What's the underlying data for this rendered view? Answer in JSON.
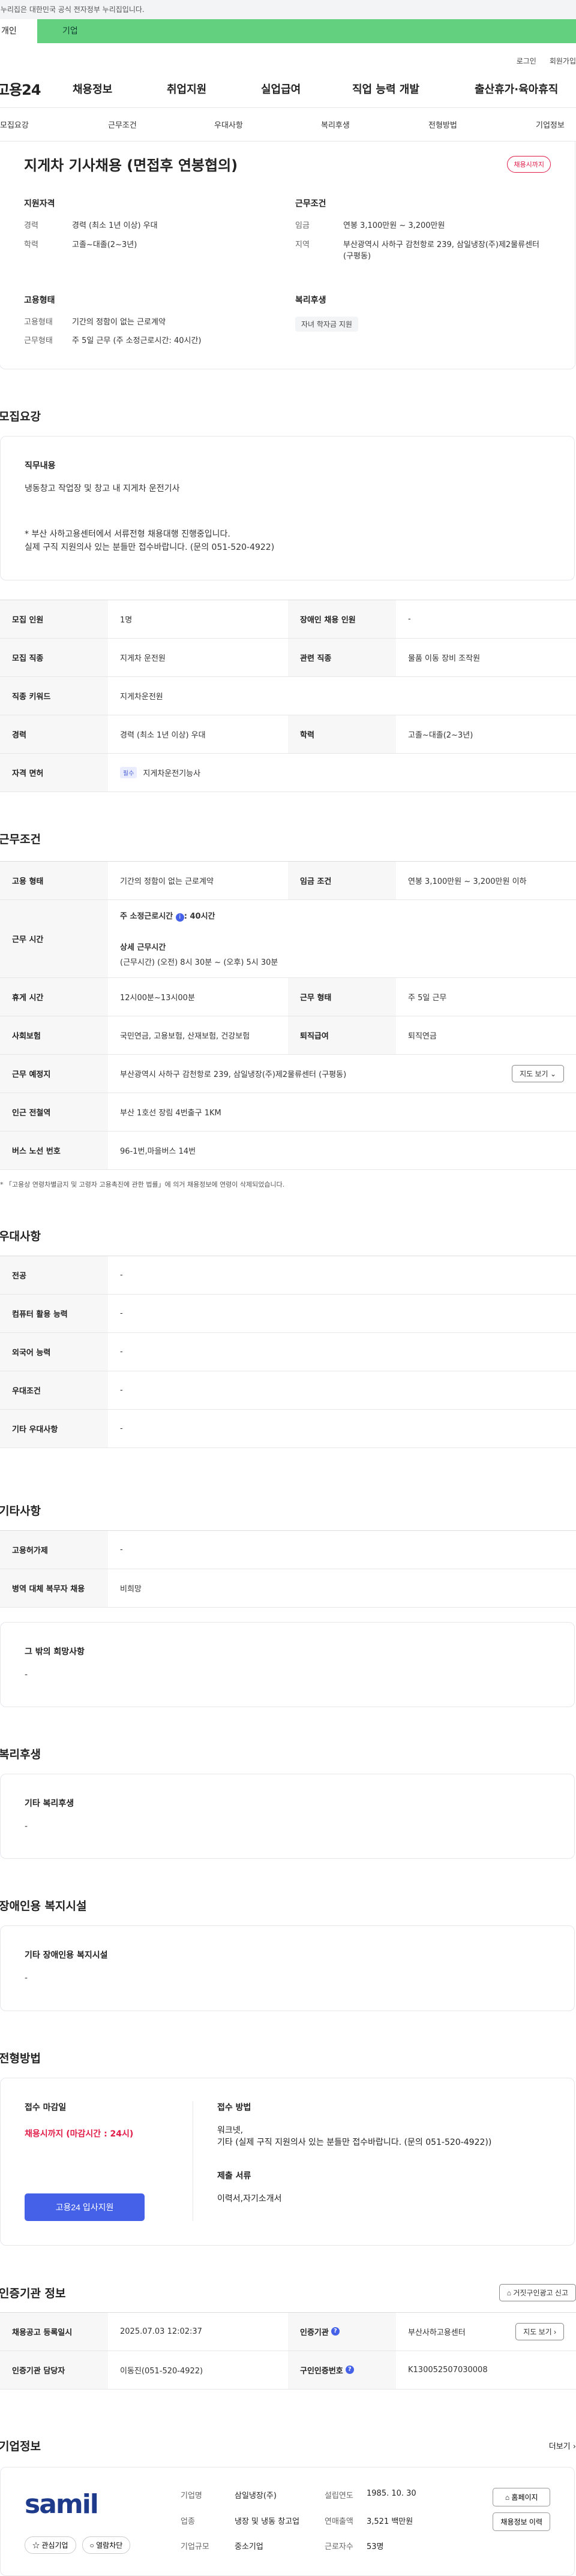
{
  "banner": {
    "text": "이 누리집은 대한민국 공식 전자정부 누리집입니다."
  },
  "user_tabs": {
    "personal": "개인",
    "company": "기업"
  },
  "util": {
    "login": "로그인",
    "join": "회원가입"
  },
  "gnb": {
    "logo": "고용24",
    "items": [
      "채용정보",
      "취업지원",
      "실업급여",
      "직업 능력 개발",
      "출산휴가·육아휴직"
    ]
  },
  "subnav": [
    "모집요강",
    "근무조건",
    "우대사항",
    "복리후생",
    "전형방법",
    "기업정보"
  ],
  "hero": {
    "title": "지게차 기사채용 (면접후 연봉협의)",
    "badge": "채용시까지",
    "qualification": {
      "title": "지원자격",
      "career_k": "경력",
      "career_v": "경력 (최소 1년 이상) 우대",
      "edu_k": "학력",
      "edu_v": "고졸~대졸(2~3년)"
    },
    "conditions": {
      "title": "근무조건",
      "wage_k": "임금",
      "wage_v": "연봉 3,100만원 ~ 3,200만원",
      "loc_k": "지역",
      "loc_v": "부산광역시 사하구 감천항로 239, 삼일냉장(주)제2물류센터 (구평동)"
    },
    "employment": {
      "title": "고용형태",
      "type_k": "고용형태",
      "type_v": "기간의 정함이 없는 근로계약",
      "form_k": "근무형태",
      "form_v": "주 5일 근무 (주 소정근로시간: 40시간)"
    },
    "welfare": {
      "title": "복리후생",
      "chip": "자녀 학자금 지원"
    }
  },
  "recruit": {
    "section": "모집요강",
    "duty_title": "직무내용",
    "duty_text": "냉동창고 작업장 및 창고 내 지게차 운전기사",
    "notice1": "* 부산 사하고용센터에서 서류전형 채용대행 진행중입니다.",
    "notice2": "실제 구직 지원의사 있는 분들만 접수바랍니다. (문의 051-520-4922)",
    "rows": {
      "count_k": "모집 인원",
      "count_v": "1명",
      "disabled_k": "장애인 채용 인원",
      "disabled_v": "-",
      "job_k": "모집 직종",
      "job_v": "지게차 운전원",
      "related_k": "관련 직종",
      "related_v": "물품 이동 장비 조작원",
      "keyword_k": "직종 키워드",
      "keyword_v": "지게차운전원",
      "career_k": "경력",
      "career_v": "경력 (최소 1년 이상) 우대",
      "edu_k": "학력",
      "edu_v": "고졸~대졸(2~3년)",
      "license_k": "자격 면허",
      "license_tag": "필수",
      "license_v": "지게차운전기능사"
    }
  },
  "work": {
    "section": "근무조건",
    "type_k": "고용 형태",
    "type_v": "기간의 정함이 없는 근로계약",
    "wage_k": "임금 조건",
    "wage_v": "연봉 3,100만원 ~ 3,200만원 이하",
    "time_k": "근무 시간",
    "time_total": "주 소정근로시간 ",
    "time_hours": ": 40시간",
    "time_detail_title": "상세 근무시간",
    "time_detail": "(근무시간) (오전) 8시 30분 ~ (오후) 5시 30분",
    "break_k": "휴게 시간",
    "break_v": "12시00분~13시00분",
    "form_k": "근무 형태",
    "form_v": "주 5일 근무",
    "ins_k": "사회보험",
    "ins_v": "국민연금, 고용보험, 산재보험, 건강보험",
    "retire_k": "퇴직급여",
    "retire_v": "퇴직연금",
    "place_k": "근무 예정지",
    "place_v": "부산광역시 사하구 감천항로 239, 삼일냉장(주)제2물류센터 (구평동)",
    "map_btn": "지도 보기",
    "subway_k": "인근 전철역",
    "subway_v": "부산 1호선 장림 4번출구 1KM",
    "bus_k": "버스 노선 번호",
    "bus_v": "96-1번,마을버스 14번",
    "note": "* 「고용상 연령차별금지 및 고령자 고용촉진에 관한 법률」에 의거 채용정보에 연령이 삭제되었습니다."
  },
  "prefer": {
    "section": "우대사항",
    "major_k": "전공",
    "major_v": "-",
    "computer_k": "컴퓨터 활용 능력",
    "computer_v": "-",
    "lang_k": "외국어 능력",
    "lang_v": "-",
    "cond_k": "우대조건",
    "cond_v": "-",
    "etc_k": "기타 우대사항",
    "etc_v": "-"
  },
  "other": {
    "section": "기타사항",
    "permit_k": "고용허가제",
    "permit_v": "-",
    "military_k": "병역 대체 복무자 채용",
    "military_v": "비희망",
    "wish_title": "그 밖의 희망사항",
    "wish_v": "-"
  },
  "welfare": {
    "section": "복리후생",
    "title": "기타 복리후생",
    "value": "-"
  },
  "disability": {
    "section": "장애인용 복지시설",
    "title": "기타 장애인용 복지시설",
    "value": "-"
  },
  "apply": {
    "section": "전형방법",
    "deadline_title": "접수 마감일",
    "deadline_v": "채용시까지 (마감시간 : 24시)",
    "method_title": "접수 방법",
    "method_v1": "워크넷,",
    "method_v2": "기타 (실제 구직 지원의사 있는 분들만 접수바랍니다. (문의 051-520-4922))",
    "docs_title": "제출 서류",
    "docs_v": "이력서,자기소개서",
    "apply_btn": "고용24 입사지원"
  },
  "cert": {
    "section": "인증기관 정보",
    "report_btn": "거짓구인광고 신고",
    "reg_k": "채용공고 등록일시",
    "reg_v": "2025.07.03 12:02:37",
    "org_k": "인증기관",
    "org_v": "부산사하고용센터",
    "map_btn": "지도 보기",
    "mgr_k": "인증기관 담당자",
    "mgr_v": "이동진(051-520-4922)",
    "id_k": "구인인증번호",
    "id_v": "K130052507030008"
  },
  "company": {
    "section": "기업정보",
    "more": "더보기",
    "logo": "samil",
    "fav_btn": "관심기업",
    "block_btn": "열람차단",
    "name_k": "기업명",
    "name_v": "삼일냉장(주)",
    "year_k": "설립연도",
    "year_v": "1985. 10. 30",
    "biz_k": "업종",
    "biz_v": "냉장 및 냉동 창고업",
    "sales_k": "연매출액",
    "sales_v": "3,521 백만원",
    "size_k": "기업규모",
    "size_v": "중소기업",
    "staff_k": "근로자수",
    "staff_v": "53명",
    "home_btn": "홈페이지",
    "history_btn": "채용정보 이력"
  }
}
